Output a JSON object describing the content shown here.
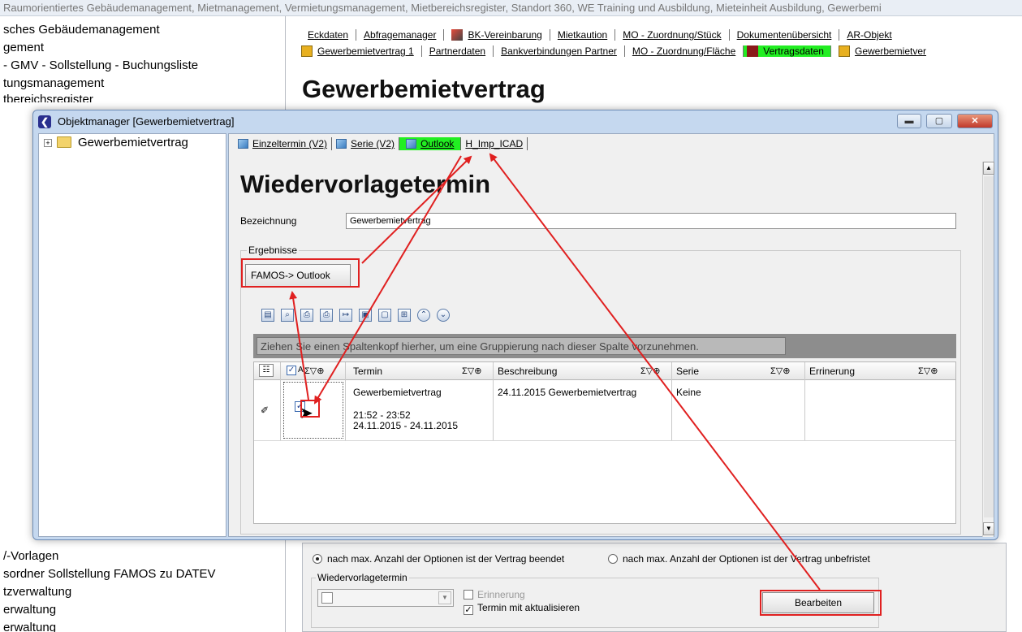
{
  "bg": {
    "title_text": "Raumorientiertes Gebäudemanagement, Mietmanagement, Vermietungsmanagement, Mietbereichsregister, Standort 360, WE Training und Ausbildung, Mieteinheit Ausbildung, Gewerbemi",
    "tree_items": [
      "sches Gebäudemanagement",
      "gement",
      "- GMV - Sollstellung - Buchungsliste",
      "tungsmanagement",
      "tbereichsregister",
      "/-Vorlagen",
      "sordner Sollstellung FAMOS zu DATEV",
      "tzverwaltung",
      "erwaltung",
      "erwaltung"
    ],
    "tabs_row1": [
      "Eckdaten",
      "Abfragemanager",
      "BK-Vereinbarung",
      "Mietkaution",
      "MO - Zuordnung/Stück",
      "Dokumentenübersicht",
      "AR-Objekt"
    ],
    "tabs_row2": [
      "Gewerbemietvertrag 1",
      "Partnerdaten",
      "Bankverbindungen Partner",
      "MO - Zuordnung/Fläche",
      "Vertragsdaten",
      "Gewerbemietver"
    ],
    "heading": "Gewerbemietvertrag",
    "radio_1": "nach max. Anzahl der Optionen ist der Vertrag beendet",
    "radio_2": "nach max. Anzahl der Optionen ist der Vertrag unbefristet",
    "wv_group_label": "Wiedervorlagetermin",
    "cb_erinnerung": "Erinnerung",
    "cb_termin": "Termin mit aktualisieren",
    "btn_bearbeiten": "Bearbeiten"
  },
  "dialog": {
    "title": "Objektmanager [Gewerbemietvertrag]",
    "tree_root": "Gewerbemietvertrag",
    "tabs": [
      "Einzeltermin (V2)",
      "Serie (V2)",
      "Outlook",
      "H_Imp_ICAD"
    ],
    "heading": "Wiedervorlagetermin",
    "bez_label": "Bezeichnung",
    "bez_value": "Gewerbemietvertrag",
    "group_label": "Ergebnisse",
    "famos_button": "FAMOS-> Outlook",
    "group_hint": "Ziehen Sie einen Spaltenkopf hierher, um eine Gruppierung nach dieser Spalte vorzunehmen.",
    "columns": [
      "A",
      "Termin",
      "Beschreibung",
      "Serie",
      "Errinerung"
    ],
    "col_symbols": "Σ▽⊕",
    "row": {
      "termin_line1": "Gewerbemietvertrag",
      "termin_line2": "21:52 - 23:52",
      "termin_line3": "24.11.2015 - 24.11.2015",
      "beschreibung": "24.11.2015 Gewerbemietvertrag",
      "serie": "Keine"
    }
  },
  "colors": {
    "highlight_green": "#22ee22",
    "annotation_red": "#e02020"
  }
}
